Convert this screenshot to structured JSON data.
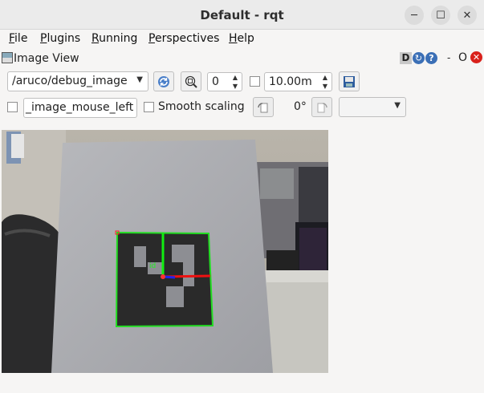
{
  "window": {
    "title": "Default - rqt",
    "minimize": "─",
    "maximize": "☐",
    "close": "✕"
  },
  "menu": {
    "file": {
      "u": "F",
      "rest": "ile"
    },
    "plugins": {
      "u": "P",
      "rest": "lugins"
    },
    "running": {
      "u": "R",
      "rest": "unning"
    },
    "perspectives": {
      "u": "P",
      "rest": "erspectives"
    },
    "help": {
      "u": "H",
      "rest": "elp"
    }
  },
  "dock": {
    "title": "Image View",
    "d_label": "D",
    "refresh_glyph": "↻",
    "help_glyph": "?",
    "float_glyph": "-",
    "o_glyph": "O",
    "close_glyph": "✕"
  },
  "toolbar": {
    "topic": "/aruco/debug_image",
    "zoom_value": "0",
    "max_range": "10.00m",
    "mouse_topic": "_image_mouse_left",
    "smooth_scaling": "Smooth scaling",
    "rotation": "0°",
    "combo_value": ""
  },
  "icons": {
    "topic_dropdown": "chevron-down-icon",
    "refresh": "refresh-icon",
    "zoom": "zoom-fit-icon",
    "save": "save-image-icon",
    "rotate_left": "rotate-left-icon",
    "rotate_right": "rotate-right-icon"
  }
}
